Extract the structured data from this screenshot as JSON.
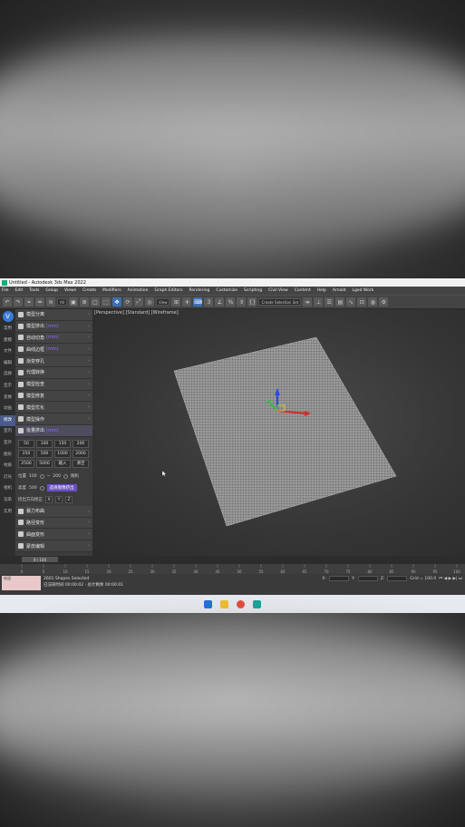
{
  "window": {
    "title": "Untitled - Autodesk 3ds Max 2022"
  },
  "menu": [
    "File",
    "Edit",
    "Tools",
    "Group",
    "Views",
    "Create",
    "Modifiers",
    "Animation",
    "Graph Editors",
    "Rendering",
    "Customize",
    "Scripting",
    "Civil View",
    "Content",
    "Help",
    "Arnold",
    "Lged Work"
  ],
  "toolbar": {
    "selection_filter": "All",
    "view_dropdown": "View",
    "selection_set": "Create Selection Set"
  },
  "left_tabs": [
    "常用",
    "建模",
    "文件",
    "编辑",
    "选择",
    "显示",
    "变换",
    "动画",
    "修改",
    "室内",
    "室外",
    "图形",
    "材质",
    "灯光",
    "相机",
    "渲染",
    "实用"
  ],
  "panel": {
    "rows": [
      {
        "label": "模型分离",
        "tag": ""
      },
      {
        "label": "模型挤出",
        "tag": "(mm)"
      },
      {
        "label": "自动切角",
        "tag": "(mm)"
      },
      {
        "label": "曲线边框",
        "tag": "(mm)"
      },
      {
        "label": "渐变穿孔",
        "tag": ""
      },
      {
        "label": "代理转换",
        "tag": ""
      },
      {
        "label": "模型检查",
        "tag": ""
      },
      {
        "label": "模型修复",
        "tag": ""
      },
      {
        "label": "模型优化",
        "tag": ""
      },
      {
        "label": "模型操作",
        "tag": ""
      }
    ],
    "batch_row": {
      "label": "批量挤出",
      "tag": "(mm)"
    },
    "buttons": [
      "50",
      "100",
      "150",
      "200",
      "250",
      "500",
      "1000",
      "2000",
      "2500",
      "5000",
      "输入",
      "清空"
    ],
    "pos_label": "位置",
    "pos_min": "100",
    "pos_sep": "~",
    "pos_max": "200",
    "random_label": "随机",
    "height_label": "高度",
    "height_val": "500",
    "apply_button": "选择图像挤出",
    "axis_label": "挤出方向修正",
    "axes": [
      "X",
      "Y",
      "Z"
    ],
    "lower_rows": [
      {
        "label": "暴力布曲",
        "tag": ""
      },
      {
        "label": "路径变形",
        "tag": ""
      },
      {
        "label": "曲面变形",
        "tag": ""
      },
      {
        "label": "蒙皮编辑",
        "tag": ""
      }
    ]
  },
  "viewport": {
    "label": "[Perspective] [Standard] [Wireframe]"
  },
  "timeline": {
    "frame_display": "0 / 100",
    "ticks": [
      "0",
      "5",
      "10",
      "15",
      "20",
      "25",
      "30",
      "35",
      "40",
      "45",
      "50",
      "55",
      "60",
      "65",
      "70",
      "75",
      "80",
      "85",
      "90",
      "95",
      "100"
    ]
  },
  "status": {
    "listener_text": "欢迎",
    "selection": "2601 Shapes Selected",
    "render_time": "已渲染时间 00:00:02 · 总计剩余 00:00:01",
    "enabled_label": "Enabled:",
    "add_time_tag": "Add Time Tag",
    "grid_label": "Grid = 100.0",
    "x_label": "X:",
    "y_label": "Y:",
    "z_label": "Z:"
  },
  "colors": {
    "accent_purple": "#6a4fc0",
    "viewport_bg": "#353535",
    "taskbar": "#e6e9ee"
  }
}
